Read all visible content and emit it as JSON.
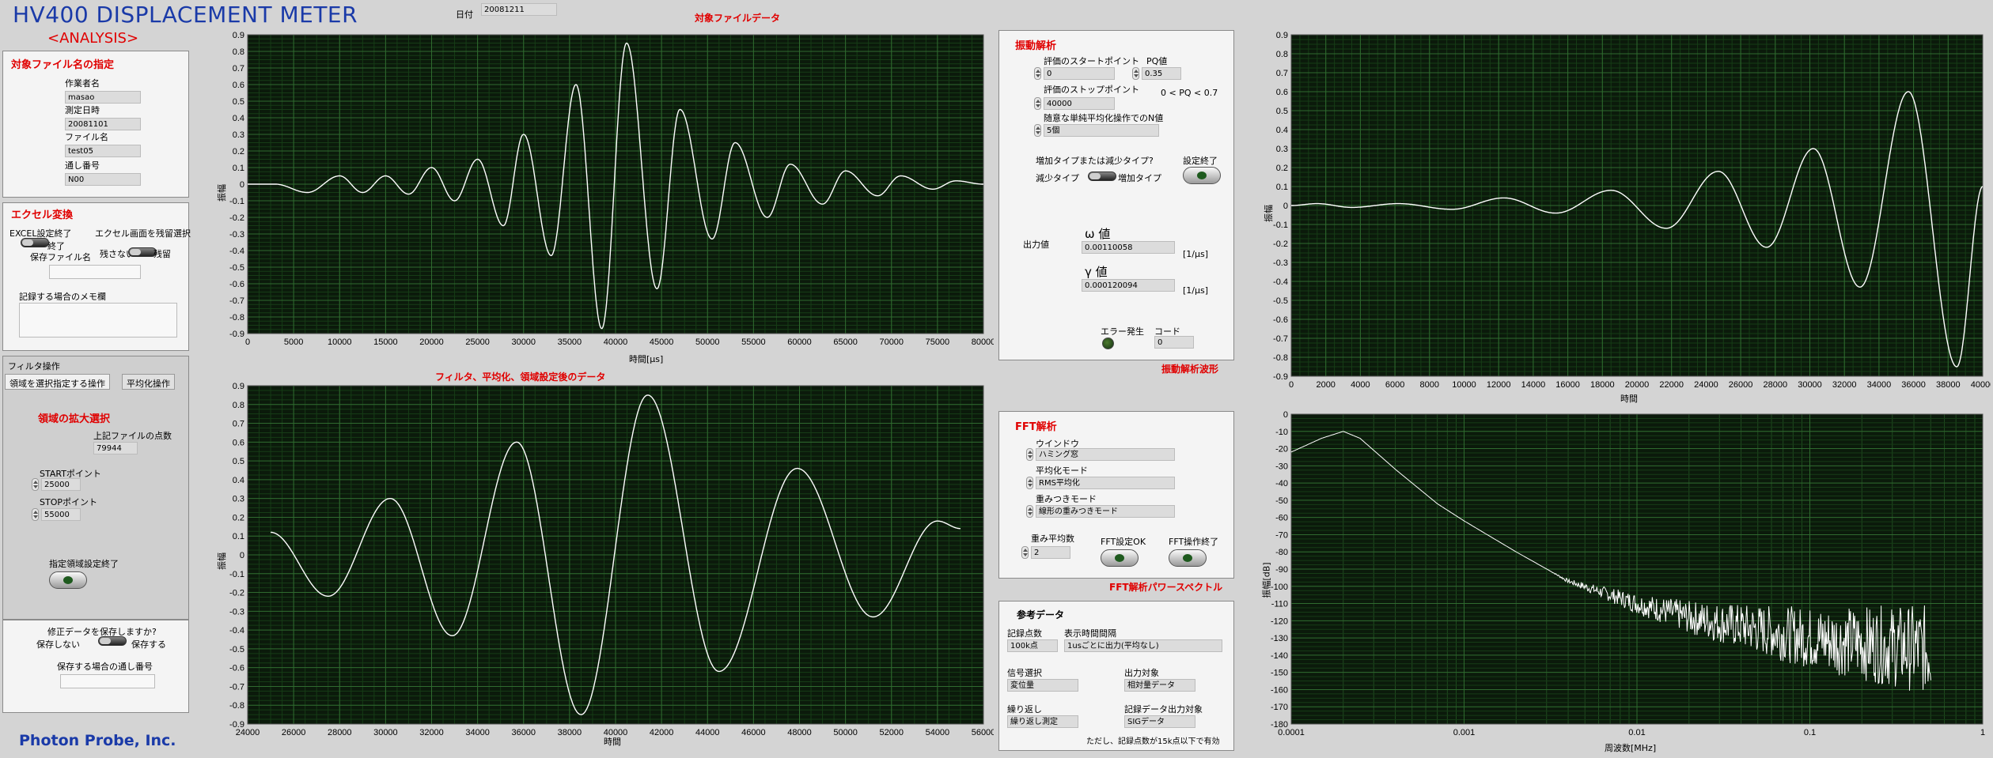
{
  "app": {
    "title": "HV400 DISPLACEMENT METER",
    "subtitle": "<ANALYSIS>",
    "company": "Photon Probe, Inc.",
    "date_label": "日付",
    "date_value": "20081211"
  },
  "target_file": {
    "heading": "対象ファイル名の指定",
    "operator_label": "作業者名",
    "operator": "masao",
    "date_label": "測定日時",
    "date": "20081101",
    "file_label": "ファイル名",
    "file": "test05",
    "serial_label": "通し番号",
    "serial": "N00"
  },
  "excel": {
    "heading": "エクセル変換",
    "setting_label": "EXCEL設定終了",
    "done_label": "終了",
    "screen_label": "エクセル画面を残留選択",
    "leave_off": "残さない",
    "leave_on": "残留",
    "savefile_label": "保存ファイル名",
    "memo_label": "記録する場合のメモ欄"
  },
  "filter": {
    "heading": "フィルタ操作",
    "tab1": "領域を選択指定する操作",
    "tab2": "平均化操作",
    "zoom_heading": "領域の拡大選択",
    "points_label": "上記ファイルの点数",
    "points": "79944",
    "start_label": "STARTポイント",
    "start": "25000",
    "stop_label": "STOPポイント",
    "stop": "55000",
    "apply_label": "指定領域設定終了"
  },
  "save": {
    "question": "修正データを保存しますか?",
    "no": "保存しない",
    "yes": "保存する",
    "serial_label": "保存する場合の通し番号"
  },
  "graph1": {
    "title": "対象ファイルデータ",
    "ylabel": "振幅",
    "xlabel": "時間[μs]"
  },
  "graph2": {
    "title": "フィルタ、平均化、領域設定後のデータ",
    "ylabel": "振幅",
    "xlabel": "時間"
  },
  "graph3": {
    "title": "振動解析波形",
    "ylabel": "振幅",
    "xlabel": "時間"
  },
  "graph4": {
    "title": "FFT解析パワースペクトル",
    "ylabel": "振幅[dB]",
    "xlabel": "周波数[MHz]"
  },
  "vibration": {
    "heading": "振動解析",
    "start_label": "評価のスタートポイント",
    "start": "0",
    "pq_label": "PQ値",
    "pq": "0.35",
    "stop_label": "評価のストップポイント",
    "stop": "40000",
    "pq_range": "0 < PQ < 0.7",
    "n_label": "随意な単純平均化操作でのN値",
    "n": "5個",
    "type_label": "増加タイプまたは減少タイプ?",
    "dec": "減少タイプ",
    "inc": "増加タイプ",
    "done_label": "設定終了",
    "output_label": "出力値",
    "omega_label": "ω 値",
    "omega": "0.00110058",
    "omega_unit": "[1/μs]",
    "gamma_label": "γ 値",
    "gamma": "0.000120094",
    "gamma_unit": "[1/μs]",
    "error_label": "エラー発生",
    "code_label": "コード",
    "code": "0"
  },
  "fft": {
    "heading": "FFT解析",
    "window_label": "ウインドウ",
    "window": "ハミング窓",
    "avg_label": "平均化モード",
    "avg": "RMS平均化",
    "weight_label": "重みつきモード",
    "weight": "線形の重みつきモード",
    "count_label": "重み平均数",
    "count": "2",
    "ok_label": "FFT設定OK",
    "end_label": "FFT操作終了"
  },
  "reference": {
    "heading": "参考データ",
    "points_label": "記録点数",
    "points": "100k点",
    "interval_label": "表示時間間隔",
    "interval": "1usごとに出力(平均なし)",
    "signal_label": "信号選択",
    "signal": "変位量",
    "output_label": "出力対象",
    "output": "相対量データ",
    "repeat_label": "繰り返し",
    "repeat": "繰り返し測定",
    "rec_label": "記録データ出力対象",
    "rec": "SIGデータ",
    "note": "ただし、記録点数が15k点以下で有効"
  },
  "chart_data": [
    {
      "type": "line",
      "name": "graph1",
      "x_range": [
        0,
        80000
      ],
      "y_range": [
        -0.9,
        0.9
      ],
      "x_ticks": [
        "0",
        "5000",
        "10000",
        "15000",
        "20000",
        "25000",
        "30000",
        "35000",
        "40000",
        "45000",
        "50000",
        "55000",
        "60000",
        "65000",
        "70000",
        "75000",
        "80000"
      ],
      "y_ticks": [
        "0.9",
        "0.8",
        "0.7",
        "0.6",
        "0.5",
        "0.4",
        "0.3",
        "0.2",
        "0.1",
        "0",
        "-0.1",
        "-0.2",
        "-0.3",
        "-0.4",
        "-0.5",
        "-0.6",
        "-0.7",
        "-0.8",
        "-0.9"
      ],
      "series": [
        {
          "peaks": [
            [
              3000,
              0.0
            ],
            [
              10000,
              0.05
            ],
            [
              15000,
              0.05
            ],
            [
              20000,
              0.1
            ],
            [
              25000,
              0.15
            ],
            [
              30000,
              0.3
            ],
            [
              35700,
              0.6
            ],
            [
              41200,
              0.85
            ],
            [
              47000,
              0.45
            ],
            [
              53000,
              0.25
            ],
            [
              59000,
              0.12
            ],
            [
              65000,
              0.08
            ],
            [
              71000,
              0.05
            ],
            [
              77000,
              0.02
            ]
          ],
          "troughs": [
            [
              6500,
              -0.05
            ],
            [
              12500,
              -0.05
            ],
            [
              17500,
              -0.06
            ],
            [
              22500,
              -0.1
            ],
            [
              27800,
              -0.25
            ],
            [
              33000,
              -0.43
            ],
            [
              38500,
              -0.87
            ],
            [
              44500,
              -0.63
            ],
            [
              50500,
              -0.33
            ],
            [
              56500,
              -0.2
            ],
            [
              62500,
              -0.12
            ],
            [
              68500,
              -0.07
            ],
            [
              74500,
              -0.03
            ]
          ]
        }
      ]
    },
    {
      "type": "line",
      "name": "graph2",
      "x_range": [
        24000,
        56000
      ],
      "y_range": [
        -0.9,
        0.9
      ],
      "x_ticks": [
        "24000",
        "26000",
        "28000",
        "30000",
        "32000",
        "34000",
        "36000",
        "38000",
        "40000",
        "42000",
        "44000",
        "46000",
        "48000",
        "50000",
        "52000",
        "54000",
        "56000"
      ],
      "y_ticks": [
        "0.9",
        "0.8",
        "0.7",
        "0.6",
        "0.5",
        "0.4",
        "0.3",
        "0.2",
        "0.1",
        "0",
        "-0.1",
        "-0.2",
        "-0.3",
        "-0.4",
        "-0.5",
        "-0.6",
        "-0.7",
        "-0.8",
        "-0.9"
      ],
      "series": [
        {
          "points": [
            [
              25000,
              0.12
            ],
            [
              27500,
              -0.22
            ],
            [
              30200,
              0.3
            ],
            [
              32900,
              -0.43
            ],
            [
              35700,
              0.6
            ],
            [
              38500,
              -0.85
            ],
            [
              41400,
              0.85
            ],
            [
              44500,
              -0.62
            ],
            [
              47900,
              0.46
            ],
            [
              51200,
              -0.33
            ],
            [
              54000,
              0.18
            ],
            [
              55000,
              0.14
            ]
          ]
        }
      ]
    },
    {
      "type": "line",
      "name": "graph3",
      "x_range": [
        0,
        40000
      ],
      "y_range": [
        -0.9,
        0.9
      ],
      "x_ticks": [
        "0",
        "2000",
        "4000",
        "6000",
        "8000",
        "10000",
        "12000",
        "14000",
        "16000",
        "18000",
        "20000",
        "22000",
        "24000",
        "26000",
        "28000",
        "30000",
        "32000",
        "34000",
        "36000",
        "38000",
        "40000"
      ],
      "y_ticks": [
        "0.9",
        "0.8",
        "0.7",
        "0.6",
        "0.5",
        "0.4",
        "0.3",
        "0.2",
        "0.1",
        "0",
        "-0.1",
        "-0.2",
        "-0.3",
        "-0.4",
        "-0.5",
        "-0.6",
        "-0.7",
        "-0.8",
        "-0.9"
      ],
      "series": [
        {
          "points": [
            [
              0,
              0
            ],
            [
              1500,
              0.01
            ],
            [
              3500,
              -0.01
            ],
            [
              6200,
              0.01
            ],
            [
              9300,
              -0.02
            ],
            [
              12300,
              0.04
            ],
            [
              15300,
              -0.04
            ],
            [
              18500,
              0.08
            ],
            [
              21700,
              -0.12
            ],
            [
              24700,
              0.18
            ],
            [
              27500,
              -0.22
            ],
            [
              30200,
              0.3
            ],
            [
              32900,
              -0.43
            ],
            [
              35700,
              0.6
            ],
            [
              38500,
              -0.85
            ],
            [
              40000,
              0.1
            ]
          ]
        }
      ]
    },
    {
      "type": "line",
      "name": "graph4",
      "x_scale": "log",
      "x_range": [
        0.0001,
        1
      ],
      "y_range": [
        -180,
        0
      ],
      "x_ticks": [
        "0.0001",
        "0.001",
        "0.01",
        "0.1",
        "1"
      ],
      "y_ticks": [
        "0",
        "-10",
        "-20",
        "-30",
        "-40",
        "-50",
        "-60",
        "-70",
        "-80",
        "-90",
        "-100",
        "-110",
        "-120",
        "-130",
        "-140",
        "-150",
        "-160",
        "-170",
        "-180"
      ],
      "series": [
        {
          "points": [
            [
              0.0001,
              -22
            ],
            [
              0.00015,
              -14
            ],
            [
              0.0002,
              -10
            ],
            [
              0.00025,
              -14
            ],
            [
              0.0004,
              -32
            ],
            [
              0.0007,
              -52
            ],
            [
              0.001,
              -62
            ],
            [
              0.002,
              -80
            ],
            [
              0.004,
              -97
            ],
            [
              0.007,
              -105
            ],
            [
              0.01,
              -110
            ],
            [
              0.02,
              -118
            ],
            [
              0.05,
              -125
            ],
            [
              0.1,
              -130
            ],
            [
              0.2,
              -133
            ],
            [
              0.5,
              -137
            ]
          ]
        }
      ]
    }
  ]
}
